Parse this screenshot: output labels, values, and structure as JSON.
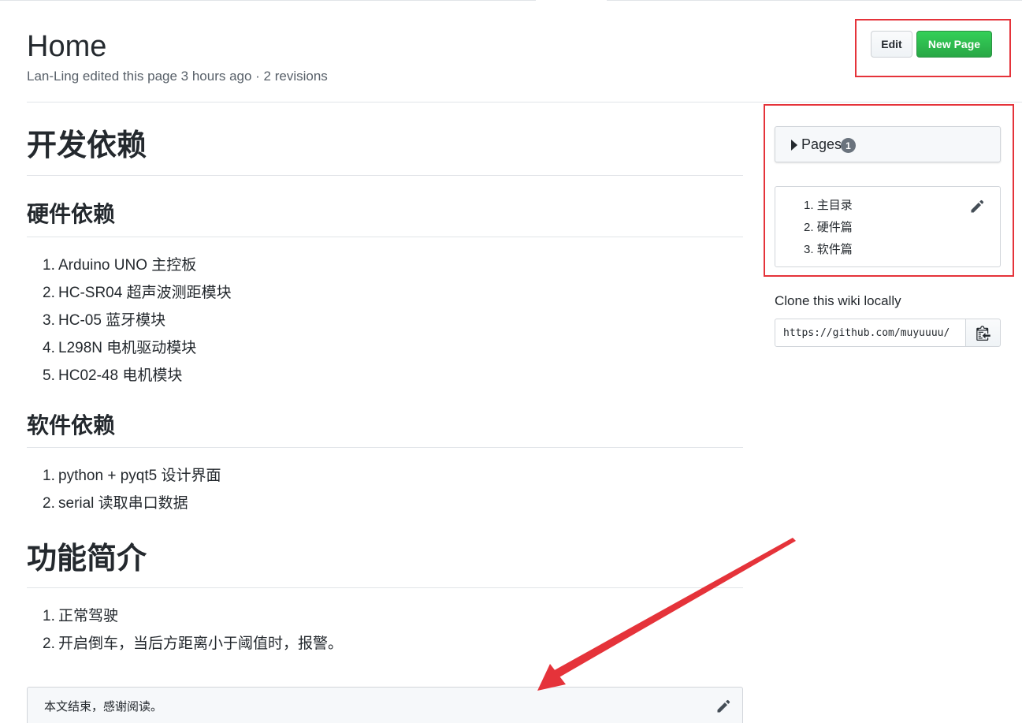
{
  "header": {
    "title": "Home",
    "meta": "Lan-Ling edited this page 3 hours ago · 2 revisions",
    "edit_label": "Edit",
    "new_page_label": "New Page"
  },
  "content": {
    "section1_title": "开发依赖",
    "hardware": {
      "title": "硬件依赖",
      "items": [
        {
          "num": "1.",
          "text": "Arduino UNO 主控板"
        },
        {
          "num": "2.",
          "text": "HC-SR04 超声波测距模块"
        },
        {
          "num": "3.",
          "text": "HC-05 蓝牙模块"
        },
        {
          "num": "4.",
          "text": "L298N 电机驱动模块"
        },
        {
          "num": "5.",
          "text": "HC02-48 电机模块"
        }
      ]
    },
    "software": {
      "title": "软件依赖",
      "items": [
        {
          "num": "1.",
          "text": "python + pyqt5 设计界面"
        },
        {
          "num": "2.",
          "text": "serial 读取串口数据"
        }
      ]
    },
    "section2_title": "功能简介",
    "features": {
      "items": [
        {
          "num": "1.",
          "text": "正常驾驶"
        },
        {
          "num": "2.",
          "text": "开启倒车，当后方距离小于阈值时，报警。"
        }
      ]
    },
    "footer_text": "本文结束，感谢阅读。"
  },
  "sidebar": {
    "pages_label": "Pages",
    "pages_count": "1",
    "toc": [
      {
        "num": "1.",
        "text": "主目录"
      },
      {
        "num": "2.",
        "text": "硬件篇"
      },
      {
        "num": "3.",
        "text": "软件篇"
      }
    ],
    "clone_label": "Clone this wiki locally",
    "clone_url": "https://github.com/muyuuuu/"
  },
  "icons": {
    "pencil": "pencil-icon",
    "clipboard": "clipboard-icon",
    "caret": "caret-right-icon"
  },
  "colors": {
    "annotation_red": "#e5333a",
    "new_page_green": "#28a745"
  }
}
